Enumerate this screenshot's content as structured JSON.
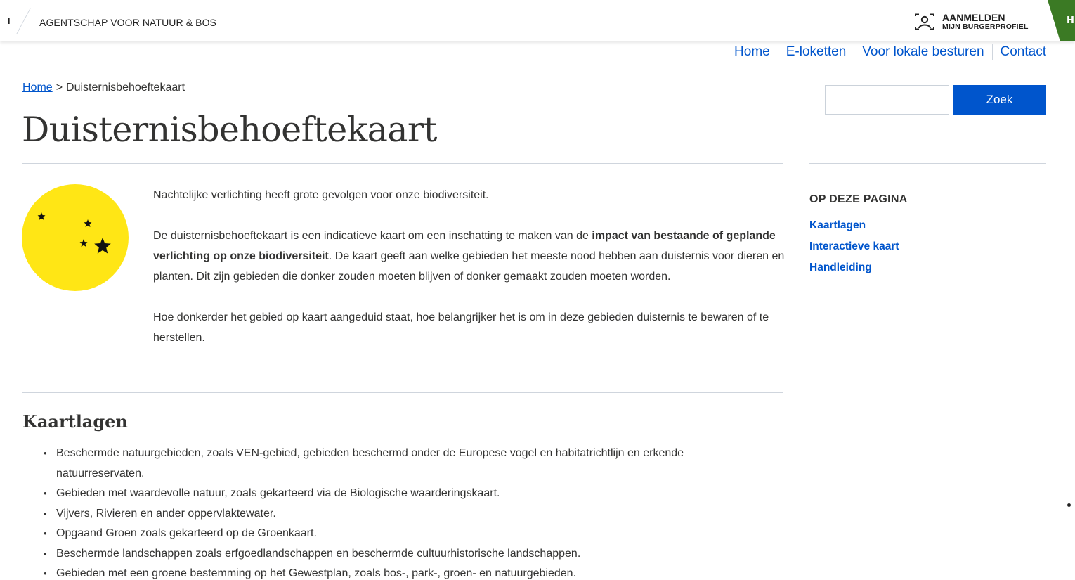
{
  "header": {
    "edge_glyph": "ı",
    "agency": "AGENTSCHAP VOOR NATUUR & BOS",
    "login_line1": "AANMELDEN",
    "login_line2": "MIJN BURGERPROFIEL",
    "green_tab_letter": "H"
  },
  "nav": {
    "items": [
      {
        "label": "Home"
      },
      {
        "label": "E-loketten"
      },
      {
        "label": "Voor lokale besturen"
      },
      {
        "label": "Contact"
      }
    ]
  },
  "breadcrumb": {
    "home": "Home",
    "separator": ">",
    "current": "Duisternisbehoeftekaart"
  },
  "page": {
    "title": "Duisternisbehoeftekaart"
  },
  "search": {
    "value": "",
    "button": "Zoek"
  },
  "sidebar": {
    "heading": "OP DEZE PAGINA",
    "items": [
      {
        "label": "Kaartlagen"
      },
      {
        "label": "Interactieve kaart"
      },
      {
        "label": "Handleiding"
      }
    ]
  },
  "intro": {
    "p1": "Nachtelijke verlichting heeft grote gevolgen voor onze biodiversiteit.",
    "p2_start": "De duisternisbehoeftekaart is een indicatieve kaart om een inschatting te maken van de ",
    "p2_bold": "impact van bestaande of geplande verlichting op onze biodiversiteit",
    "p2_end": ". De kaart geeft aan welke gebieden het meeste nood hebben aan duisternis voor dieren en planten. Dit zijn gebieden die donker zouden moeten blijven of donker gemaakt zouden moeten worden.",
    "p3": "Hoe donkerder het gebied op kaart aangeduid staat, hoe belangrijker het is om in deze gebieden duisternis te bewaren of te herstellen."
  },
  "kaartlagen": {
    "heading": "Kaartlagen",
    "items": [
      "Beschermde natuurgebieden, zoals VEN-gebied, gebieden beschermd onder de Europese vogel en habitatrichtlijn en erkende natuurreservaten.",
      "Gebieden met waardevolle natuur, zoals gekarteerd via de Biologische waarderingskaart.",
      "Vijvers, Rivieren en ander oppervlaktewater.",
      "Opgaand Groen zoals gekarteerd op de Groenkaart.",
      "Beschermde landschappen zoals erfgoedlandschappen en beschermde cultuurhistorische landschappen.",
      "Gebieden met een groene bestemming op het Gewestplan, zoals bos-, park-, groen- en natuurgebieden."
    ]
  },
  "colors": {
    "link_blue": "#0055cc",
    "text": "#333332",
    "moon_yellow": "#ffe615",
    "green_tab": "#3b7a24"
  },
  "icons": {
    "login": "profile-frame-icon",
    "illustration": "moon-and-stars-icon"
  }
}
